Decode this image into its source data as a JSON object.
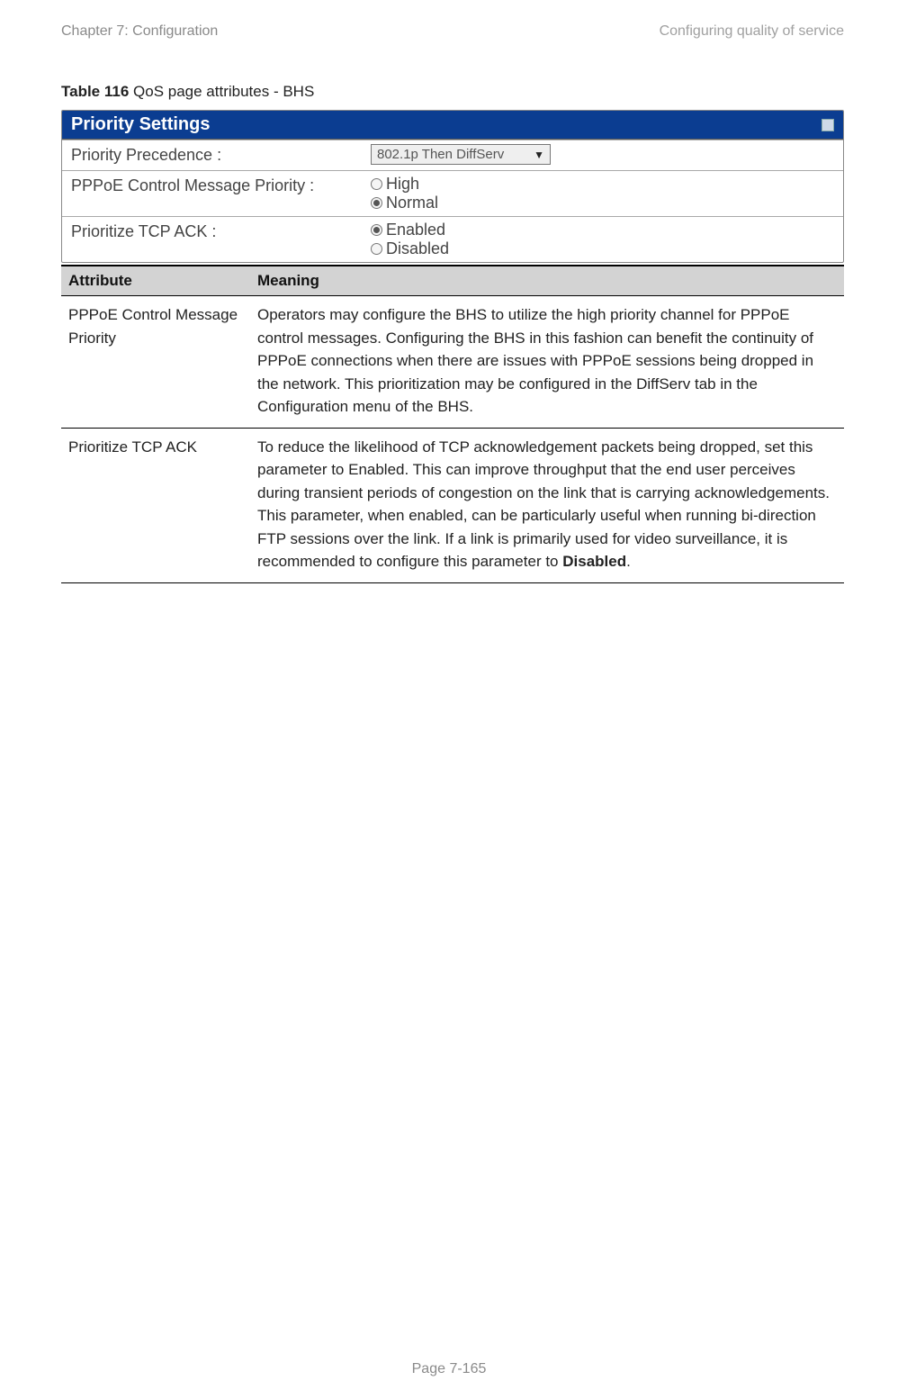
{
  "header": {
    "left": "Chapter 7:  Configuration",
    "right": "Configuring quality of service"
  },
  "caption": {
    "bold": "Table 116",
    "rest": " QoS page attributes - BHS"
  },
  "panel": {
    "title": "Priority Settings",
    "rows": [
      {
        "label": "Priority Precedence :",
        "type": "select",
        "value": "802.1p Then DiffServ"
      },
      {
        "label": "PPPoE Control Message Priority :",
        "type": "radio",
        "options": [
          {
            "label": "High",
            "checked": false
          },
          {
            "label": "Normal",
            "checked": true
          }
        ]
      },
      {
        "label": "Prioritize TCP ACK :",
        "type": "radio",
        "options": [
          {
            "label": "Enabled",
            "checked": true
          },
          {
            "label": "Disabled",
            "checked": false
          }
        ]
      }
    ]
  },
  "attr_table": {
    "head": {
      "col1": "Attribute",
      "col2": "Meaning"
    },
    "rows": [
      {
        "attr": "PPPoE Control Message Priority",
        "meaning": "Operators may configure the BHS to utilize the high priority channel for PPPoE control messages. Configuring the BHS in this fashion can benefit the continuity of PPPoE connections when there are issues with PPPoE sessions being dropped in the network. This prioritization may be configured in the DiffServ tab in the Configuration menu of the BHS."
      },
      {
        "attr": "Prioritize TCP ACK",
        "meaning_pre": "To reduce the likelihood of TCP acknowledgement packets being dropped, set this parameter to Enabled. This can improve throughput that the end user perceives during transient periods of congestion on the link that is carrying acknowledgements. This parameter, when enabled, can be particularly useful when running bi-direction FTP sessions over the link. If a link is primarily used for video surveillance, it is recommended to configure this parameter to ",
        "meaning_bold": "Disabled",
        "meaning_post": "."
      }
    ]
  },
  "footer": "Page 7-165"
}
